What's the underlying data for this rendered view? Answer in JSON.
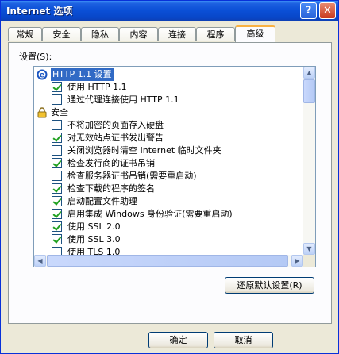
{
  "window": {
    "title": "Internet 选项",
    "help_label": "?",
    "close_label": "✕"
  },
  "tabs": [
    {
      "label": "常规",
      "active": false
    },
    {
      "label": "安全",
      "active": false
    },
    {
      "label": "隐私",
      "active": false
    },
    {
      "label": "内容",
      "active": false
    },
    {
      "label": "连接",
      "active": false
    },
    {
      "label": "程序",
      "active": false
    },
    {
      "label": "高级",
      "active": true
    }
  ],
  "settings": {
    "label": "设置(S):",
    "items": [
      {
        "text": "HTTP 1.1 设置",
        "kind": "group",
        "icon": "ie-icon",
        "selected": true
      },
      {
        "text": "使用 HTTP 1.1",
        "kind": "check",
        "checked": true
      },
      {
        "text": "通过代理连接使用 HTTP 1.1",
        "kind": "check",
        "checked": false
      },
      {
        "text": "安全",
        "kind": "group",
        "icon": "lock-icon",
        "selected": false
      },
      {
        "text": "不将加密的页面存入硬盘",
        "kind": "check",
        "checked": false
      },
      {
        "text": "对无效站点证书发出警告",
        "kind": "check",
        "checked": true
      },
      {
        "text": "关闭浏览器时清空 Internet 临时文件夹",
        "kind": "check",
        "checked": false
      },
      {
        "text": "检查发行商的证书吊销",
        "kind": "check",
        "checked": true
      },
      {
        "text": "检查服务器证书吊销(需要重启动)",
        "kind": "check",
        "checked": false
      },
      {
        "text": "检查下载的程序的签名",
        "kind": "check",
        "checked": true
      },
      {
        "text": "启动配置文件助理",
        "kind": "check",
        "checked": true
      },
      {
        "text": "启用集成 Windows 身份验证(需要重启动)",
        "kind": "check",
        "checked": true
      },
      {
        "text": "使用 SSL 2.0",
        "kind": "check",
        "checked": true
      },
      {
        "text": "使用 SSL 3.0",
        "kind": "check",
        "checked": true
      },
      {
        "text": "使用 TLS 1.0",
        "kind": "check",
        "checked": false
      }
    ]
  },
  "restore_button": "还原默认设置(R)",
  "footer": {
    "ok": "确定",
    "cancel": "取消"
  }
}
